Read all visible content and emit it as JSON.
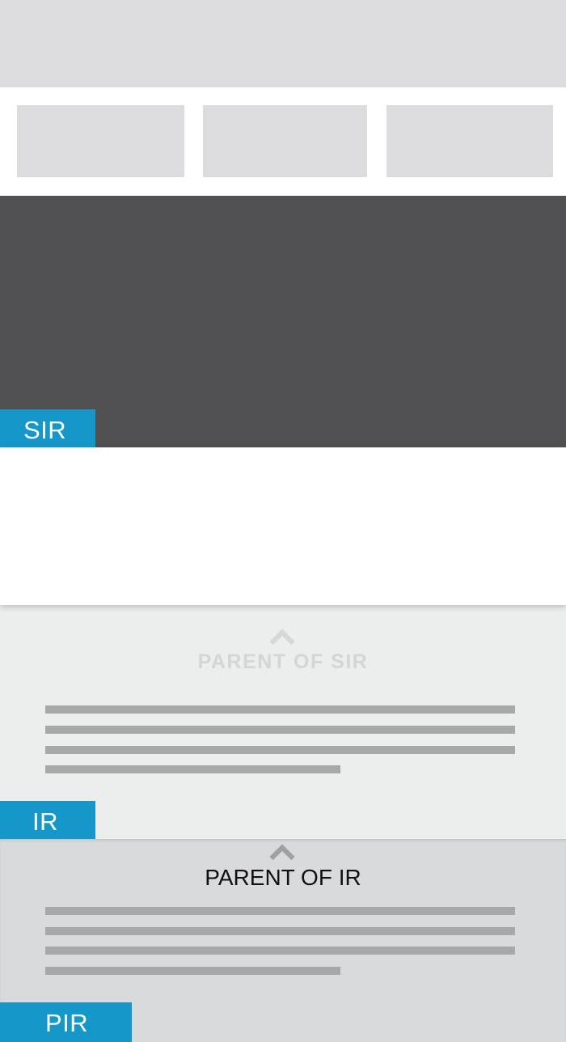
{
  "top_banner": {},
  "card_row": {
    "cards": 3
  },
  "hero": {
    "tag": "SIR"
  },
  "parent_sir": {
    "heading": "PARENT OF SIR",
    "icon": "chevron-up-icon",
    "tag": "IR",
    "text_lines": 4
  },
  "parent_ir": {
    "heading": "PARENT OF IR",
    "icon": "chevron-up-icon",
    "tag": "PIR",
    "text_lines": 4
  },
  "colors": {
    "accent": "#1597c9",
    "hero": "#505052",
    "placeholder": "#dcdcde",
    "text_line": "#a7a8aa",
    "parent_sir_bg": "#eceeed",
    "parent_ir_bg": "#d9dadc"
  }
}
